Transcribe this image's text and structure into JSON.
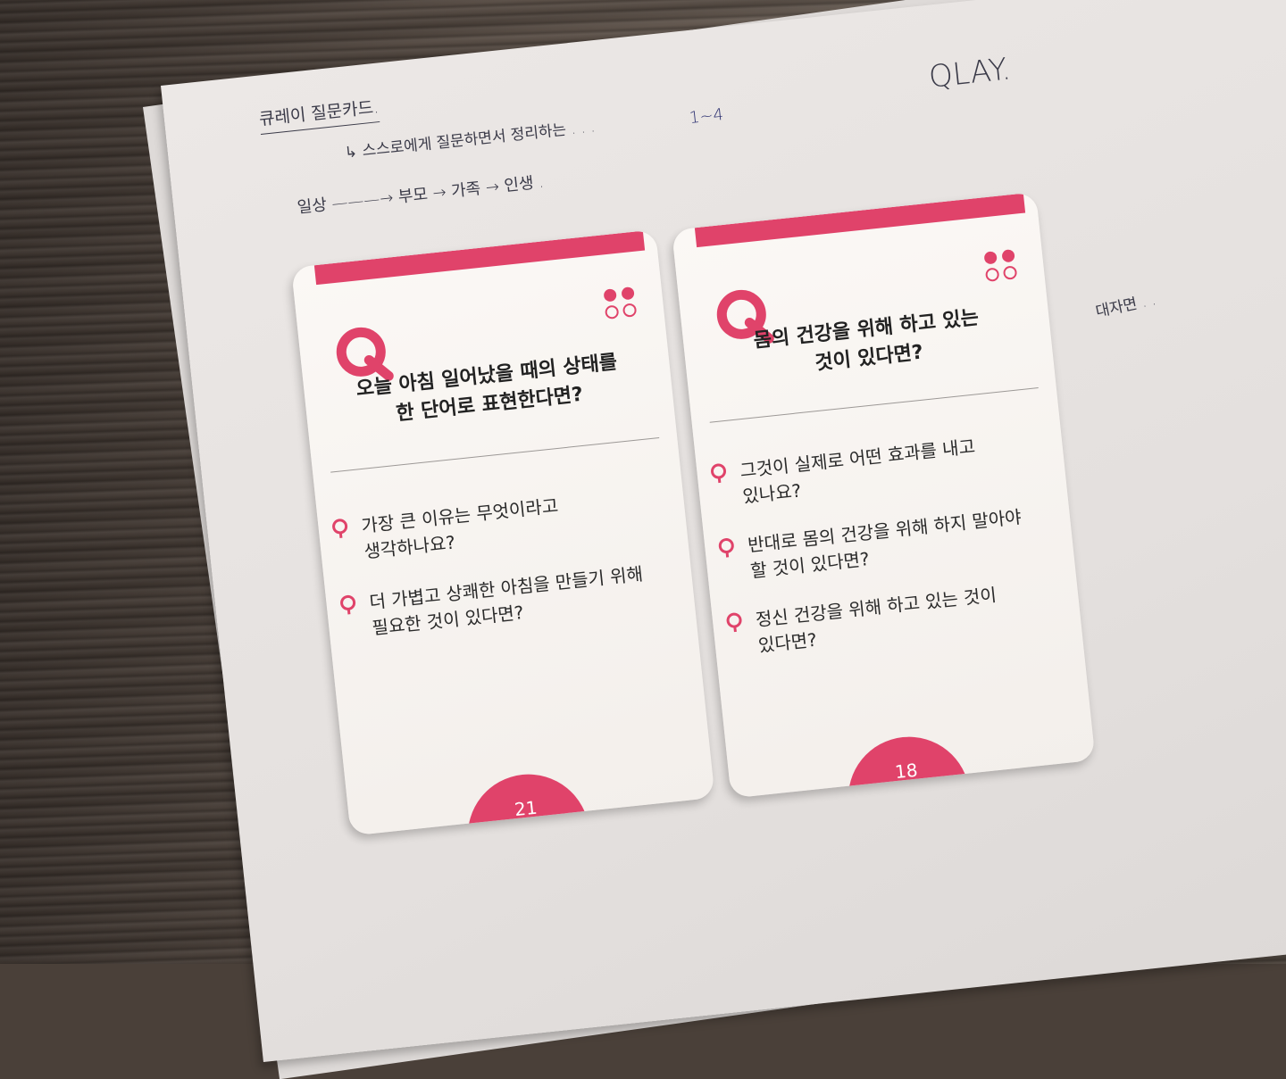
{
  "handwriting": {
    "brand": "QLAY.",
    "line1": "큐레이 질문카드.",
    "line2": "↳ 스스로에게 질문하면서 정리하는 . . .",
    "line2_side": "1~4",
    "line3": "일상 ———→ 부모 → 가족 → 인생 .",
    "side_note": "대자면 . ."
  },
  "cards": [
    {
      "title": "오늘 아침 일어났을 때의 상태를\n한 단어로 표현한다면?",
      "items": [
        "가장 큰 이유는 무엇이라고\n생각하나요?",
        "더 가볍고 상쾌한 아침을 만들기 위해\n필요한 것이 있다면?"
      ],
      "number": "21"
    },
    {
      "title": "몸의 건강을 위해 하고 있는\n것이 있다면?",
      "items": [
        "그것이 실제로 어떤 효과를 내고\n있나요?",
        "반대로 몸의 건강을 위해 하지 말아야\n할 것이 있다면?",
        "정신 건강을 위해 하고 있는 것이\n있다면?"
      ],
      "number": "18"
    }
  ],
  "colors": {
    "accent": "#e0436a",
    "card": "#f8f5f2",
    "paper": "#e8e4e2"
  },
  "icons": [
    "q-logo-icon",
    "two-dots-icon",
    "q-bullet-icon"
  ]
}
